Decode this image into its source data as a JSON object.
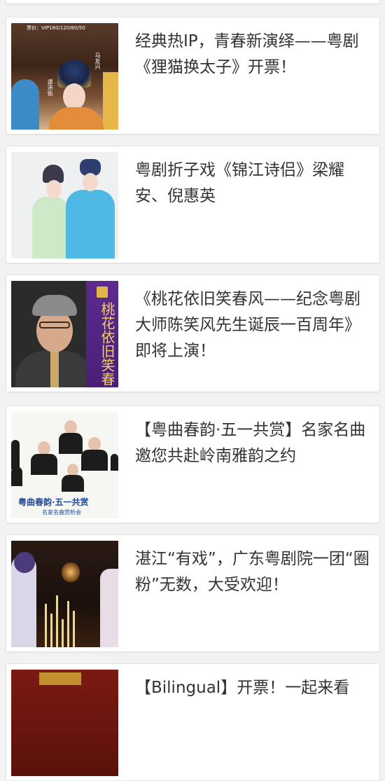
{
  "articles": [
    {
      "title": "",
      "thumbnail": ""
    },
    {
      "title": "经典热IP，青春新演绎——粤剧《狸猫换太子》开票！",
      "thumbnail": "opera-poster-limao",
      "thumb_text": {
        "price": "票价：VIP180/120/80/50",
        "name_a": "马友兴",
        "name_b": "谭沛佑"
      }
    },
    {
      "title": "粤剧折子戏《锦江诗侣》梁耀安、倪惠英",
      "thumbnail": "opera-couple-photo"
    },
    {
      "title": "《桃花依旧笑春风——纪念粤剧大师陈笑风先生诞辰一百周年》即将上演！",
      "thumbnail": "portrait-chen-xiaofeng",
      "thumb_text": {
        "banner": "桃花依旧笑春"
      }
    },
    {
      "title": "【粤曲春韵·五一共赏】名家名曲邀您共赴岭南雅韵之约",
      "thumbnail": "yueqv-concert-poster",
      "thumb_text": {
        "caption": "粤曲春韵·五一共赏",
        "subcaption": "名家名曲赏析会"
      }
    },
    {
      "title": "湛江“有戏”，广东粤剧院一团“圈粉”无数，大受欢迎！",
      "thumbnail": "stage-performance-photo"
    },
    {
      "title": "【Bilingual】开票！一起来看",
      "thumbnail": "red-poster"
    }
  ],
  "colors": {
    "background": "#f2f2f2",
    "card": "#ffffff",
    "text": "#333333",
    "accent_blue": "#1f4aa0"
  }
}
